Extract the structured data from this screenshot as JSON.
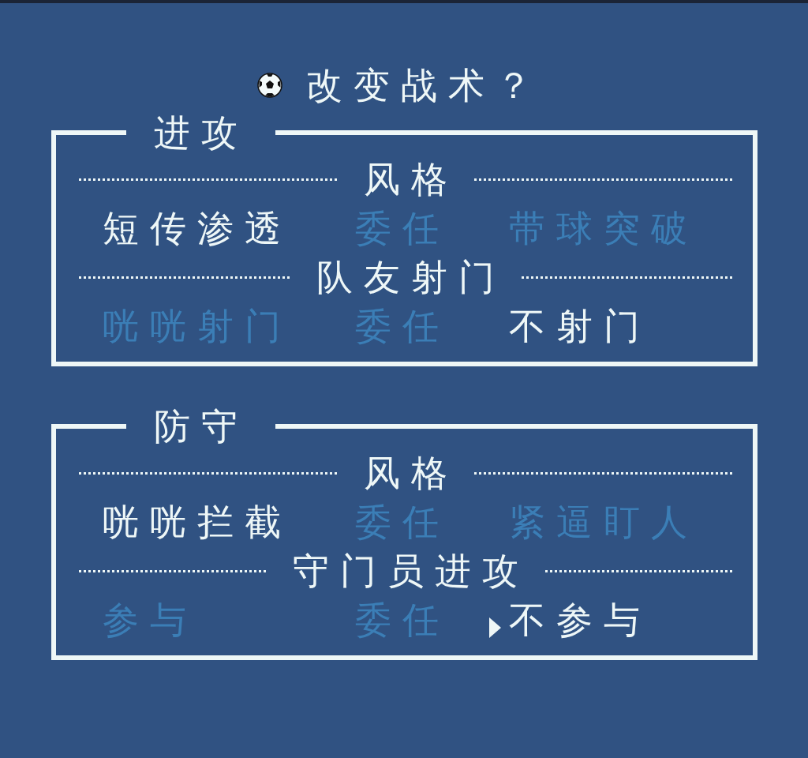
{
  "title": "改变战术？",
  "sections": [
    {
      "title": "进攻",
      "groups": [
        {
          "heading": "风格",
          "options": [
            {
              "label": "短传渗透",
              "selected": true,
              "focused": false
            },
            {
              "label": "委任",
              "selected": false,
              "focused": false
            },
            {
              "label": "带球突破",
              "selected": false,
              "focused": false
            }
          ]
        },
        {
          "heading": "队友射门",
          "options": [
            {
              "label": "咣咣射门",
              "selected": false,
              "focused": false
            },
            {
              "label": "委任",
              "selected": false,
              "focused": false
            },
            {
              "label": "不射门",
              "selected": true,
              "focused": false
            }
          ]
        }
      ]
    },
    {
      "title": "防守",
      "groups": [
        {
          "heading": "风格",
          "options": [
            {
              "label": "咣咣拦截",
              "selected": true,
              "focused": false
            },
            {
              "label": "委任",
              "selected": false,
              "focused": false
            },
            {
              "label": "紧逼盯人",
              "selected": false,
              "focused": false
            }
          ]
        },
        {
          "heading": "守门员进攻",
          "options": [
            {
              "label": "参与",
              "selected": false,
              "focused": false
            },
            {
              "label": "委任",
              "selected": false,
              "focused": false
            },
            {
              "label": "不参与",
              "selected": true,
              "focused": true
            }
          ]
        }
      ]
    }
  ]
}
